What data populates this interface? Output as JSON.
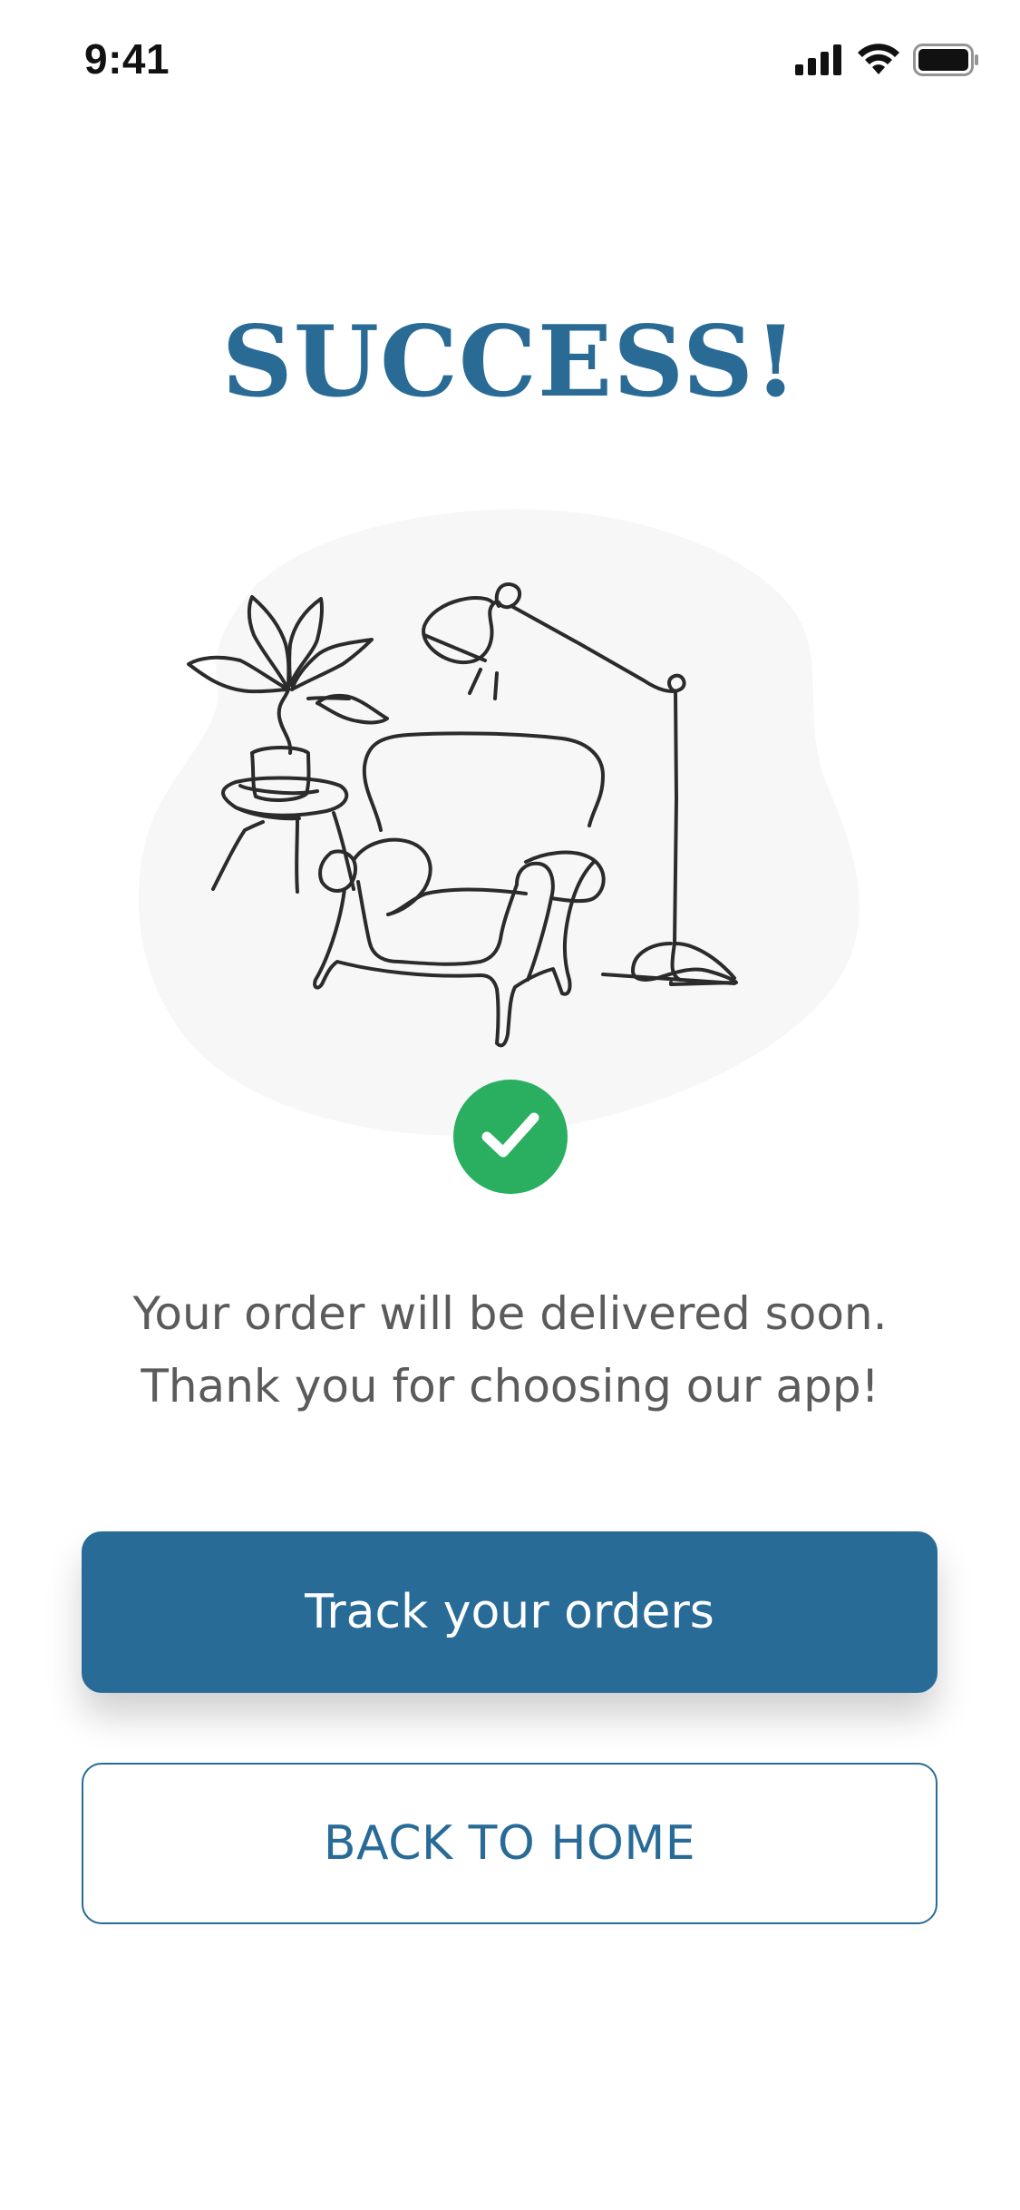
{
  "status_bar": {
    "time": "9:41",
    "icons": [
      "cellular-signal-icon",
      "wifi-icon",
      "battery-icon"
    ]
  },
  "title": "SUCCESS!",
  "illustration": {
    "subject": "line-art armchair, floor lamp and potted plant",
    "badge_icon": "checkmark-icon"
  },
  "message": {
    "line1": "Your order will be delivered soon.",
    "line2": "Thank you for choosing our app!"
  },
  "buttons": {
    "primary_label": "Track your orders",
    "secondary_label": "BACK TO HOME"
  },
  "colors": {
    "brand_blue": "#296b97",
    "success_green": "#2aae5f",
    "text_gray": "#5b5b5b",
    "blob_gray": "#f7f7f7"
  }
}
